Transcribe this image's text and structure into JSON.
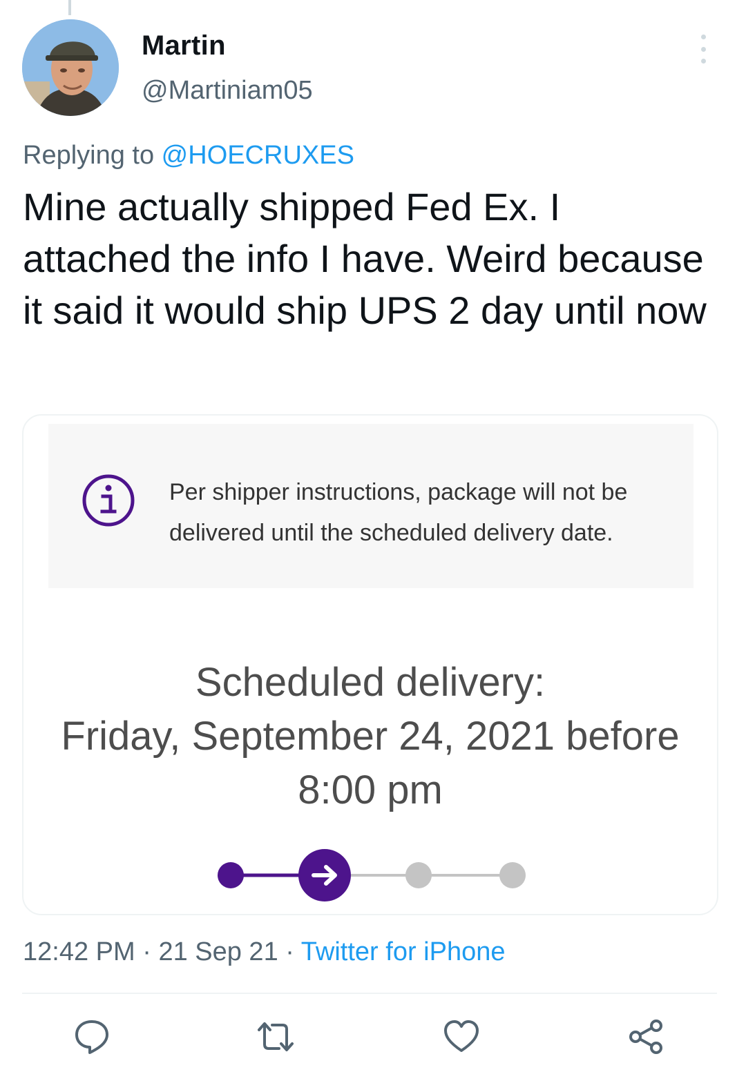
{
  "tweet": {
    "author_name": "Martin",
    "author_handle": "@Martiniam05",
    "replying_prefix": "Replying to ",
    "replying_handle": "@HOECRUXES",
    "text": "Mine actually shipped Fed Ex. I attached the info I have. Weird because it said it would ship UPS 2 day until now",
    "time": "12:42 PM",
    "date": "21 Sep 21",
    "source": "Twitter for iPhone",
    "separator": " · "
  },
  "attachment": {
    "notice_text": "Per shipper instructions, package will not be delivered until the scheduled delivery date.",
    "scheduled_label": "Scheduled delivery:",
    "scheduled_datetime": "Friday, September 24, 2021 before",
    "scheduled_time": "8:00 pm",
    "progress": {
      "steps_total": 4,
      "current_step": 2
    },
    "colors": {
      "accent": "#4d148c",
      "inactive": "#c4c4c4",
      "info": "#4d148c"
    }
  },
  "actions": {
    "reply_icon": "reply-icon",
    "retweet_icon": "retweet-icon",
    "like_icon": "heart-icon",
    "share_icon": "share-icon"
  },
  "colors": {
    "link": "#1d9bf0",
    "secondary_text": "#536471",
    "primary_text": "#0f1419"
  }
}
